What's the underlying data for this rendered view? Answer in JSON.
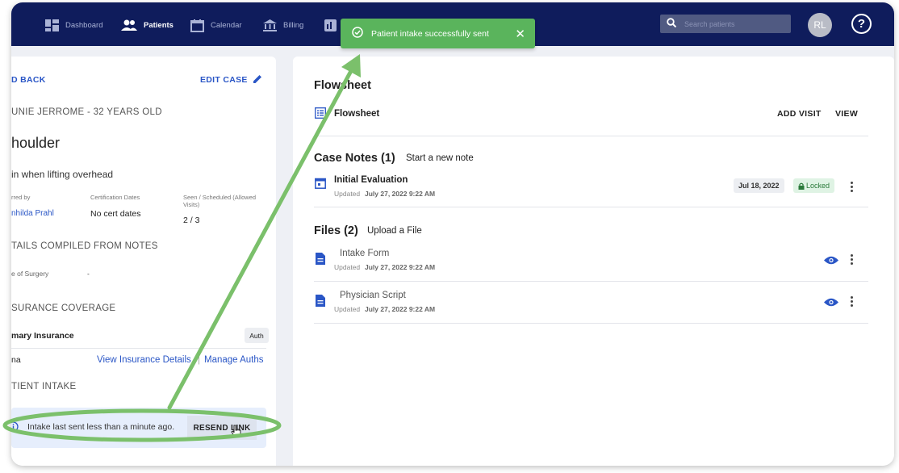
{
  "nav": {
    "items": [
      {
        "label": "Dashboard",
        "icon": "dashboard-icon"
      },
      {
        "label": "Patients",
        "icon": "patients-icon"
      },
      {
        "label": "Calendar",
        "icon": "calendar-icon"
      },
      {
        "label": "Billing",
        "icon": "billing-icon"
      }
    ],
    "search_placeholder": "Search patients",
    "avatar_initials": "RL",
    "help_glyph": "?"
  },
  "toast": {
    "message": "Patient intake successfully sent",
    "close_glyph": "✕"
  },
  "left": {
    "back_label": "D BACK",
    "edit_case_label": "EDIT CASE",
    "patient_line": "UNIE JERROME - 32 YEARS OLD",
    "case_title": "houlder",
    "complaint": "in when lifting overhead",
    "referred_by_label": "rred by",
    "referred_by_value": "nhilda Prahl",
    "cert_dates_label": "Certification Dates",
    "cert_dates_value": "No cert dates",
    "seen_label_1": "Seen / Scheduled (Allowed",
    "seen_label_2": "Visits)",
    "seen_value": "2 / 3",
    "details_heading": "TAILS COMPILED FROM NOTES",
    "surgery_label": "e of Surgery",
    "surgery_value": "-",
    "insurance_heading": "SURANCE COVERAGE",
    "primary_insurance_label": "mary Insurance",
    "auth_chip": "Auth",
    "insurer_name": "na",
    "view_insurance_link": "View Insurance Details",
    "manage_auths_link": "Manage Auths",
    "intake_heading": "TIENT INTAKE",
    "intake_status": "Intake last sent less than a minute ago.",
    "resend_label": "RESEND LINK"
  },
  "right": {
    "flowsheet_heading": "Flowsheet",
    "flowsheet_item": "Flowsheet",
    "add_visit_label": "ADD VISIT",
    "view_label": "VIEW",
    "case_notes_heading": "Case Notes (1)",
    "new_note_link": "Start a new note",
    "notes": [
      {
        "title": "Initial Evaluation",
        "updated": "July 27, 2022 9:22 AM",
        "date_chip": "Jul 18, 2022",
        "status_chip": "Locked"
      }
    ],
    "files_heading": "Files (2)",
    "upload_link": "Upload a File",
    "updated_prefix": "Updated",
    "files": [
      {
        "name": "Intake Form",
        "updated": "July 27, 2022 9:22 AM"
      },
      {
        "name": "Physician Script",
        "updated": "July 27, 2022 9:22 AM"
      }
    ]
  },
  "colors": {
    "nav_bg": "#0f1c5c",
    "toast_bg": "#5ab45c",
    "link": "#2a56c6",
    "annotation": "#7bc06b",
    "locked_chip_bg": "#dff3e4"
  }
}
